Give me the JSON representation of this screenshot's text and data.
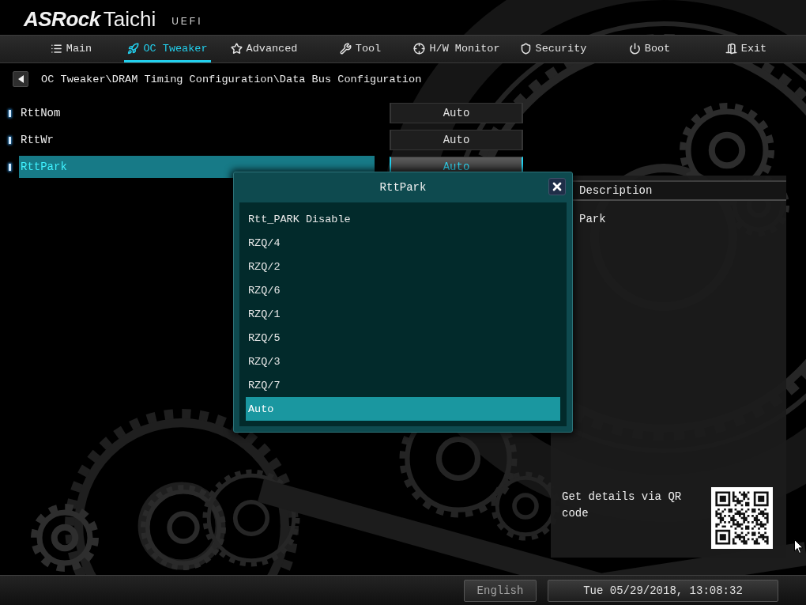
{
  "header": {
    "logo": {
      "brand": "ASRock",
      "model": "Taichi",
      "tag": "UEFI"
    }
  },
  "tabs": [
    {
      "label": "Main",
      "selected": false
    },
    {
      "label": "OC Tweaker",
      "selected": true
    },
    {
      "label": "Advanced",
      "selected": false
    },
    {
      "label": "Tool",
      "selected": false
    },
    {
      "label": "H/W Monitor",
      "selected": false
    },
    {
      "label": "Security",
      "selected": false
    },
    {
      "label": "Boot",
      "selected": false
    },
    {
      "label": "Exit",
      "selected": false
    }
  ],
  "breadcrumb": {
    "path": "OC Tweaker\\DRAM Timing Configuration\\Data Bus Configuration"
  },
  "settings": [
    {
      "label": "RttNom",
      "value": "Auto",
      "selected": false
    },
    {
      "label": "RttWr",
      "value": "Auto",
      "selected": false
    },
    {
      "label": "RttPark",
      "value": "Auto",
      "selected": true
    }
  ],
  "popup": {
    "title": "RttPark",
    "options": [
      {
        "label": "Rtt_PARK Disable",
        "selected": false
      },
      {
        "label": "RZQ/4",
        "selected": false
      },
      {
        "label": "RZQ/2",
        "selected": false
      },
      {
        "label": "RZQ/6",
        "selected": false
      },
      {
        "label": "RZQ/1",
        "selected": false
      },
      {
        "label": "RZQ/5",
        "selected": false
      },
      {
        "label": "RZQ/3",
        "selected": false
      },
      {
        "label": "RZQ/7",
        "selected": false
      },
      {
        "label": "Auto",
        "selected": true
      }
    ]
  },
  "description": {
    "title": "Description",
    "text": "Park",
    "qr_hint": "Get details via QR code"
  },
  "status_bar": {
    "language": "English",
    "datetime": "Tue 05/29/2018, 13:08:32"
  }
}
